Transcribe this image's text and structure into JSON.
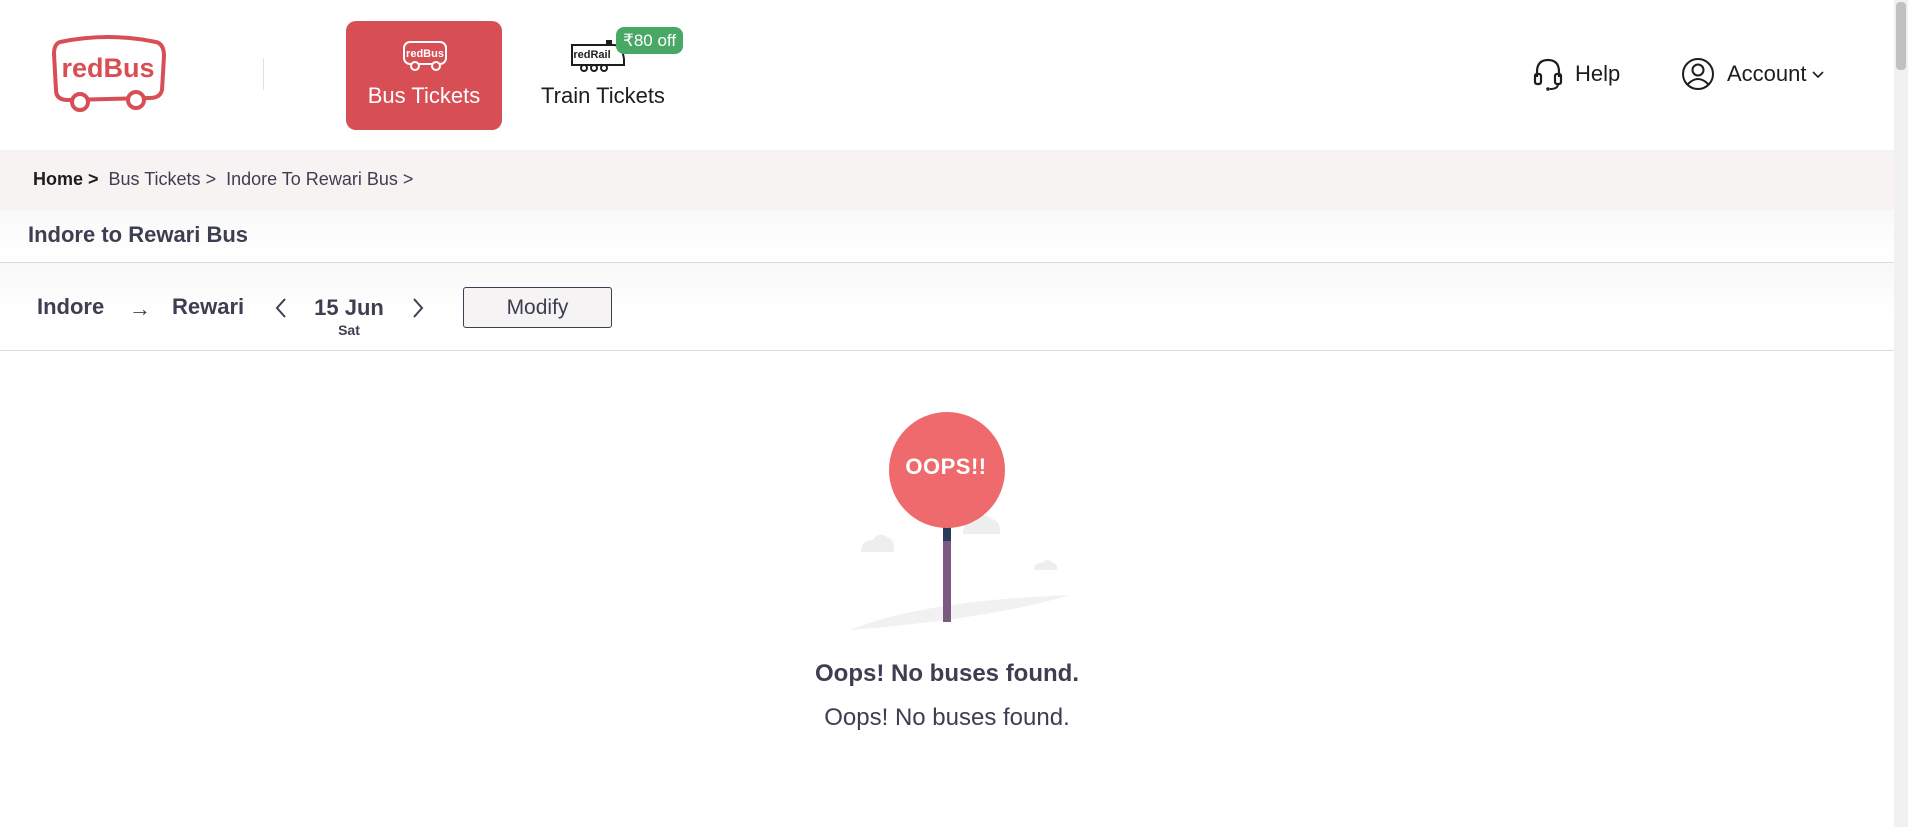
{
  "header": {
    "logo_text": "redBus",
    "tabs": [
      {
        "label": "Bus Tickets",
        "icon": "redbus-bus-icon",
        "logo_text": "redBus",
        "active": true
      },
      {
        "label": "Train Tickets",
        "icon": "redrail-train-icon",
        "logo_text": "redRail",
        "active": false
      }
    ],
    "offer_badge": "₹80 off",
    "help_label": "Help",
    "account_label": "Account"
  },
  "breadcrumb": {
    "home": "Home >",
    "items": [
      "Bus Tickets >",
      "Indore To Rewari Bus >"
    ]
  },
  "page_title": "Indore to Rewari Bus",
  "search": {
    "from": "Indore",
    "arrow": "→",
    "to": "Rewari",
    "date": "15 Jun",
    "day": "Sat",
    "modify_label": "Modify"
  },
  "empty_state": {
    "sign_text": "OOPS!!",
    "title": "Oops! No buses found.",
    "subtitle": "Oops! No buses found."
  },
  "colors": {
    "brand_red": "#d84e55",
    "sign_red": "#ef6a6c",
    "offer_green": "#4aa867",
    "text_dark": "#3e3e52"
  }
}
